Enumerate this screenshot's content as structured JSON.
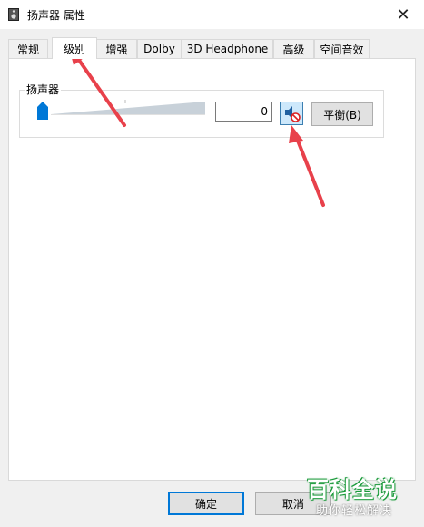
{
  "window": {
    "title": "扬声器 属性",
    "close_glyph": "✕"
  },
  "tabs": [
    {
      "label": "常规"
    },
    {
      "label": "级别"
    },
    {
      "label": "增强"
    },
    {
      "label": "Dolby"
    },
    {
      "label": "3D Headphone"
    },
    {
      "label": "高级"
    },
    {
      "label": "空间音效"
    }
  ],
  "active_tab": "级别",
  "levels": {
    "group_label": "扬声器",
    "volume_value": "0",
    "volume_fraction": 0.0,
    "muted": true,
    "balance_label": "平衡(B)"
  },
  "footer": {
    "ok_label": "确定",
    "cancel_label": "取消"
  },
  "watermark": {
    "main": "百科全说",
    "sub": "助你轻松解决"
  },
  "icons": {
    "window": "speaker-device-icon",
    "mute": "speaker-muted-icon",
    "annotation": "red-arrow"
  },
  "colors": {
    "accent": "#0078d7",
    "arrow": "#e8414b",
    "watermark_green": "#1a9a3a"
  }
}
